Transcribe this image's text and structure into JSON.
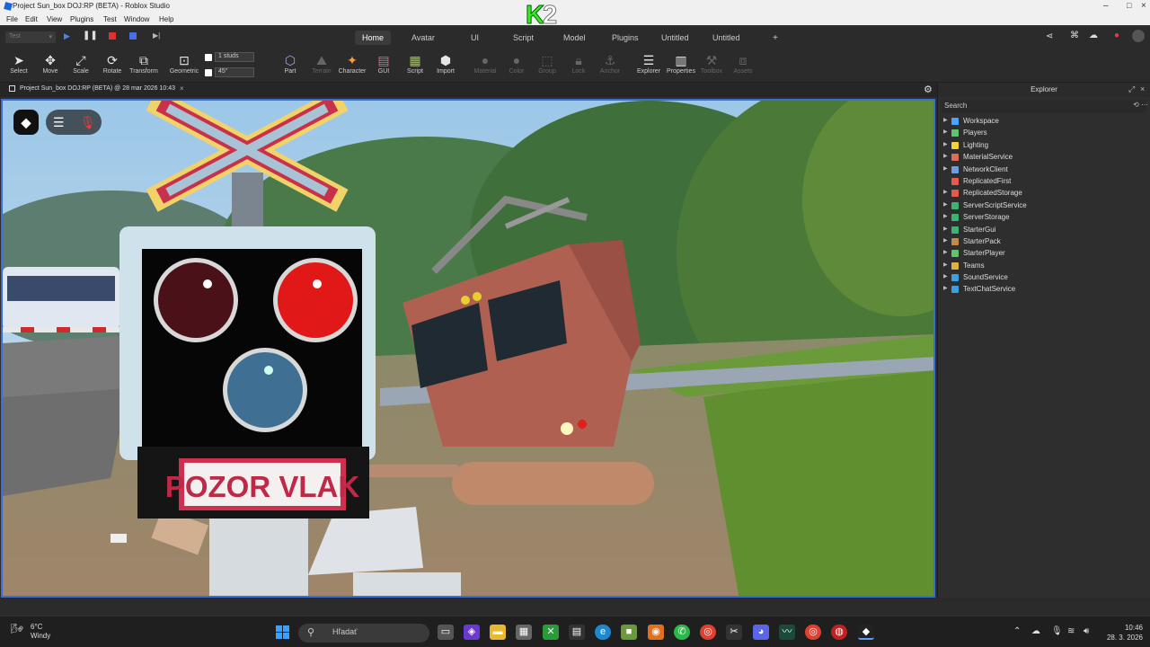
{
  "window": {
    "title": "Project Sun_box DOJ:RP (BETA) - Roblox Studio"
  },
  "watermark": {
    "k": "K",
    "two": "2"
  },
  "menu": [
    "File",
    "Edit",
    "View",
    "Plugins",
    "Test",
    "Window",
    "Help"
  ],
  "test_selector": {
    "value": "Test"
  },
  "tabs": [
    {
      "label": "Home",
      "active": true
    },
    {
      "label": "Avatar"
    },
    {
      "label": "UI"
    },
    {
      "label": "Script"
    },
    {
      "label": "Model"
    },
    {
      "label": "Plugins"
    },
    {
      "label": "Untitled"
    },
    {
      "label": "Untitled"
    }
  ],
  "ribbon": {
    "tools": [
      {
        "label": "Select",
        "icon": "cursor-icon"
      },
      {
        "label": "Move",
        "icon": "move-icon"
      },
      {
        "label": "Scale",
        "icon": "scale-icon"
      },
      {
        "label": "Rotate",
        "icon": "rotate-icon"
      },
      {
        "label": "Transform",
        "icon": "transform-icon"
      },
      {
        "label": "Geometric",
        "icon": "geometric-icon"
      }
    ],
    "snap": {
      "move_value": "1 studs",
      "rotate_value": "45°"
    },
    "insert_tools": [
      {
        "label": "Part",
        "enabled": true
      },
      {
        "label": "Terrain",
        "enabled": false
      },
      {
        "label": "Character",
        "enabled": true
      },
      {
        "label": "GUI",
        "enabled": true
      },
      {
        "label": "Script",
        "enabled": true
      },
      {
        "label": "Import",
        "enabled": true
      }
    ],
    "edit_tools": [
      {
        "label": "Material",
        "enabled": false
      },
      {
        "label": "Color",
        "enabled": false
      },
      {
        "label": "Group",
        "enabled": false
      },
      {
        "label": "Lock",
        "enabled": false
      },
      {
        "label": "Anchor",
        "enabled": false
      }
    ],
    "window_tools": [
      {
        "label": "Explorer",
        "enabled": true
      },
      {
        "label": "Properties",
        "enabled": true
      },
      {
        "label": "Toolbox",
        "enabled": false
      },
      {
        "label": "Assets",
        "enabled": false
      }
    ]
  },
  "document_tab": {
    "label": "Project Sun_box DOJ:RP (BETA) @ 28 mar 2026 10:43"
  },
  "scene": {
    "sign_text": "POZOR VLAK"
  },
  "explorer": {
    "title": "Explorer",
    "search_placeholder": "Search",
    "items": [
      {
        "label": "Workspace",
        "color": "#4aa3ff",
        "expandable": true
      },
      {
        "label": "Players",
        "color": "#5fc36f",
        "expandable": true
      },
      {
        "label": "Lighting",
        "color": "#f2d33c",
        "expandable": true
      },
      {
        "label": "MaterialService",
        "color": "#e06a5a",
        "expandable": true
      },
      {
        "label": "NetworkClient",
        "color": "#6aa0e0",
        "expandable": true
      },
      {
        "label": "ReplicatedFirst",
        "color": "#e65a4a",
        "expandable": false
      },
      {
        "label": "ReplicatedStorage",
        "color": "#e65a4a",
        "expandable": true
      },
      {
        "label": "ServerScriptService",
        "color": "#3cb371",
        "expandable": true
      },
      {
        "label": "ServerStorage",
        "color": "#3cb371",
        "expandable": true
      },
      {
        "label": "StarterGui",
        "color": "#3cb371",
        "expandable": true
      },
      {
        "label": "StarterPack",
        "color": "#c08a4a",
        "expandable": true
      },
      {
        "label": "StarterPlayer",
        "color": "#5fc36f",
        "expandable": true
      },
      {
        "label": "Teams",
        "color": "#e0b040",
        "expandable": true
      },
      {
        "label": "SoundService",
        "color": "#3aa0e0",
        "expandable": true
      },
      {
        "label": "TextChatService",
        "color": "#3aa0e0",
        "expandable": true
      }
    ]
  },
  "taskbar": {
    "weather_temp": "6°C",
    "weather_desc": "Windy",
    "search_label": "Hľadať",
    "time": "10:46",
    "date": "28. 3. 2026"
  }
}
